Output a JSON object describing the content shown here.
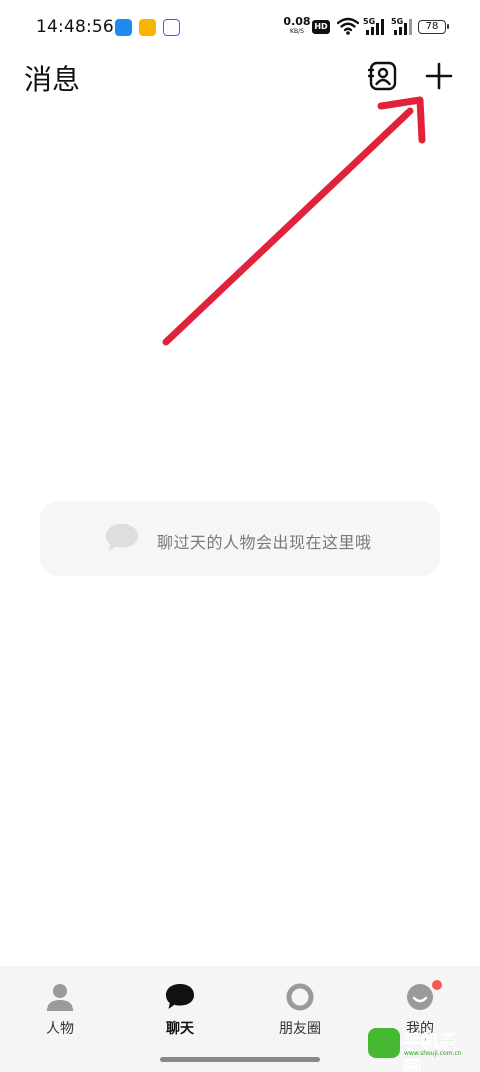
{
  "status_bar": {
    "time": "14:48:56",
    "net_speed_value": "0.08",
    "net_speed_unit": "KB/S",
    "hd_label": "HD",
    "signal_1_label": "5G",
    "signal_2_label": "5G",
    "battery_level": "78"
  },
  "header": {
    "title": "消息"
  },
  "empty_state": {
    "message": "聊过天的人物会出现在这里哦"
  },
  "bottom_nav": {
    "items": [
      {
        "label": "人物",
        "icon": "person-icon",
        "active": false
      },
      {
        "label": "聊天",
        "icon": "chat-bubble-icon",
        "active": true
      },
      {
        "label": "朋友圈",
        "icon": "moments-ring-icon",
        "active": false
      },
      {
        "label": "我的",
        "icon": "profile-face-icon",
        "active": false
      }
    ]
  },
  "annotation": {
    "arrow_color": "#e0233a"
  },
  "watermark": {
    "text": "手机乐园",
    "url": "www.shouji.com.cn"
  },
  "colors": {
    "background": "#ffffff",
    "nav_background": "#f5f5f5",
    "empty_card": "#f6f6f6",
    "badge": "#f25b4b"
  }
}
